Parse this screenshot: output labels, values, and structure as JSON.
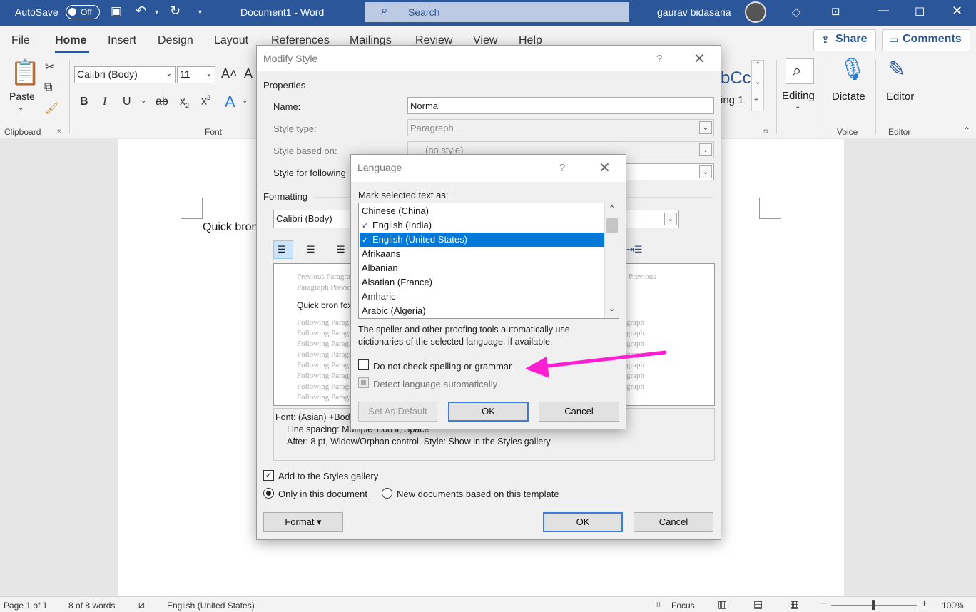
{
  "titlebar": {
    "autosave": "AutoSave",
    "autosave_state": "Off",
    "doc_title": "Document1  -  Word",
    "search": "Search",
    "user": "gaurav bidasaria"
  },
  "ribbon": {
    "tabs": [
      "File",
      "Home",
      "Insert",
      "Design",
      "Layout",
      "References",
      "Mailings",
      "Review",
      "View",
      "Help"
    ],
    "share": "Share",
    "comments": "Comments",
    "paste": "Paste",
    "clipboard": "Clipboard",
    "font_group": "Font",
    "font_name": "Calibri (Body)",
    "font_size": "11",
    "style_preview": "bCc",
    "style_heading": "ing 1",
    "editing": "Editing",
    "dictate": "Dictate",
    "voice": "Voice",
    "editor": "Editor",
    "editor_group": "Editor"
  },
  "document": {
    "text": "Quick bron"
  },
  "modify_style": {
    "title": "Modify Style",
    "help": "?",
    "properties": "Properties",
    "name_label": "Name:",
    "name_value": "Normal",
    "style_type_label": "Style type:",
    "style_type_value": "Paragraph",
    "based_on_label": "Style based on:",
    "based_on_value": "(no style)",
    "following_label": "Style for following",
    "formatting": "Formatting",
    "font_value": "Calibri (Body)",
    "preview_prev1": "Previous Paragra",
    "preview_prev2": "Paragraph Previo",
    "preview_prev_right": "Previous",
    "preview_sample": "Quick bron fox",
    "preview_following": "Following Paragra",
    "preview_following_right": "graph",
    "desc_line1": "Font: (Asian) +Bod",
    "desc_line2": "Line spacing:  Multiple 1.08 li, Space",
    "desc_line3": "After:  8 pt, Widow/Orphan control, Style: Show in the Styles gallery",
    "add_gallery": "Add to the Styles gallery",
    "only_doc": "Only in this document",
    "new_docs": "New documents based on this template",
    "format_btn": "Format ▾",
    "ok": "OK",
    "cancel": "Cancel"
  },
  "language": {
    "title": "Language",
    "help": "?",
    "mark_label": "Mark selected text as:",
    "items": [
      "Chinese (China)",
      "English (India)",
      "English (United States)",
      "Afrikaans",
      "Albanian",
      "Alsatian (France)",
      "Amharic",
      "Arabic (Algeria)"
    ],
    "selected_index": 2,
    "info": "The speller and other proofing tools automatically use",
    "info2": "dictionaries of the selected language, if available.",
    "no_check": "Do not check spelling or grammar",
    "detect": "Detect language automatically",
    "set_default": "Set As Default",
    "ok": "OK",
    "cancel": "Cancel"
  },
  "statusbar": {
    "page": "Page 1 of 1",
    "words": "8 of 8 words",
    "language": "English (United States)",
    "focus": "Focus",
    "zoom": "100%"
  },
  "colors": {
    "title_blue": "#2b579a",
    "selection": "#0078d7",
    "arrow": "#ff1fd2"
  }
}
